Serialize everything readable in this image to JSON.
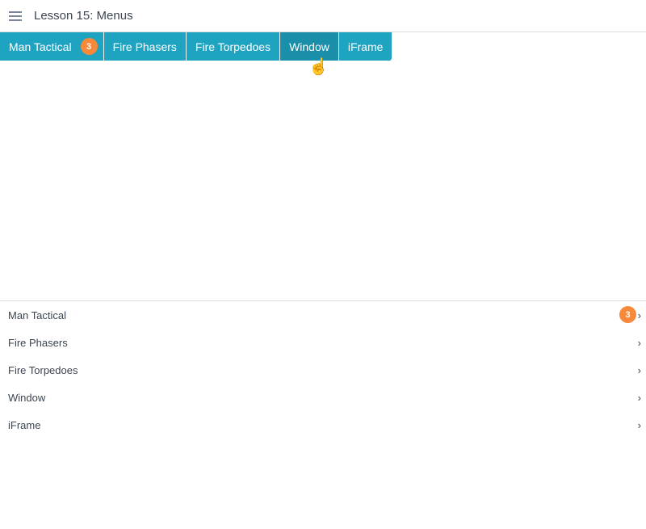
{
  "header": {
    "title": "Lesson 15: Menus"
  },
  "tabs": [
    {
      "label": "Man Tactical",
      "badge": "3"
    },
    {
      "label": "Fire Phasers"
    },
    {
      "label": "Fire Torpedoes"
    },
    {
      "label": "Window"
    },
    {
      "label": "iFrame"
    }
  ],
  "list": [
    {
      "label": "Man Tactical",
      "badge": "3"
    },
    {
      "label": "Fire Phasers"
    },
    {
      "label": "Fire Torpedoes"
    },
    {
      "label": "Window"
    },
    {
      "label": "iFrame"
    }
  ],
  "colors": {
    "tab": "#1ea3c1",
    "tab_hover": "#198fa9",
    "badge": "#f8883a"
  }
}
